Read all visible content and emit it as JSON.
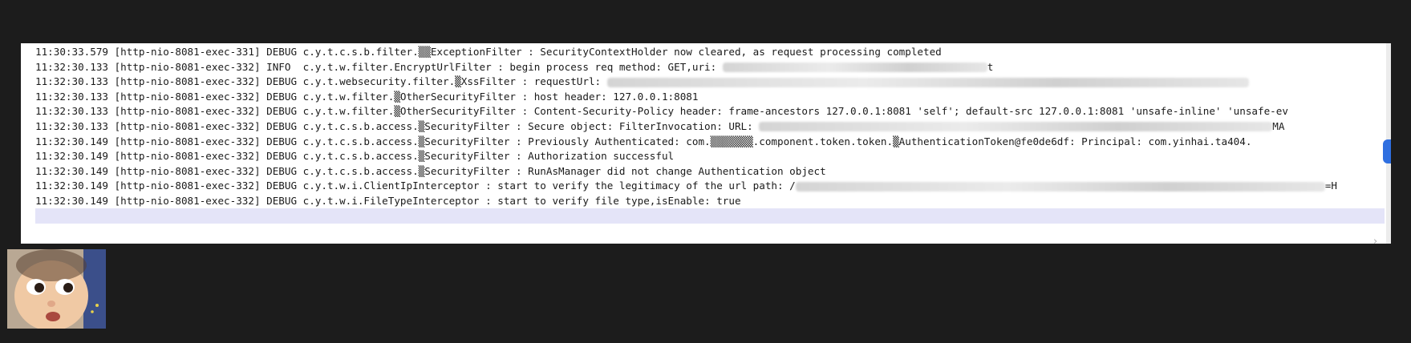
{
  "log": {
    "lines": [
      {
        "text": "11:30:33.579 [http-nio-8081-exec-331] DEBUG c.y.t.c.s.b.filter.▒▒ExceptionFilter : SecurityContextHolder now cleared, as request processing completed"
      },
      {
        "text": "11:32:30.133 [http-nio-8081-exec-332] INFO  c.y.t.w.filter.EncryptUrlFilter : begin process req method: GET,uri: ",
        "redacted_tail": true,
        "tail": "t"
      },
      {
        "text": "11:32:30.133 [http-nio-8081-exec-332] DEBUG c.y.t.websecurity.filter.▒XssFilter : requestUrl: ",
        "redacted_tail": true,
        "tail": ""
      },
      {
        "text": "11:32:30.133 [http-nio-8081-exec-332] DEBUG c.y.t.w.filter.▒OtherSecurityFilter : host header: 127.0.0.1:8081"
      },
      {
        "text": "11:32:30.133 [http-nio-8081-exec-332] DEBUG c.y.t.w.filter.▒OtherSecurityFilter : Content-Security-Policy header: frame-ancestors 127.0.0.1:8081 'self'; default-src 127.0.0.1:8081 'unsafe-inline' 'unsafe-ev"
      },
      {
        "text": "11:32:30.133 [http-nio-8081-exec-332] DEBUG c.y.t.c.s.b.access.▒SecurityFilter : Secure object: FilterInvocation: URL: ",
        "redacted_tail": true,
        "tail": "MA"
      },
      {
        "text": "11:32:30.149 [http-nio-8081-exec-332] DEBUG c.y.t.c.s.b.access.▒SecurityFilter : Previously Authenticated: com.▒▒▒▒▒▒▒.component.token.token.▒AuthenticationToken@fe0de6df: Principal: com.yinhai.ta404."
      },
      {
        "text": "11:32:30.149 [http-nio-8081-exec-332] DEBUG c.y.t.c.s.b.access.▒SecurityFilter : Authorization successful"
      },
      {
        "text": "11:32:30.149 [http-nio-8081-exec-332] DEBUG c.y.t.c.s.b.access.▒SecurityFilter : RunAsManager did not change Authentication object"
      },
      {
        "text": "11:32:30.149 [http-nio-8081-exec-332] DEBUG c.y.t.w.i.ClientIpInterceptor : start to verify the legitimacy of the url path: /",
        "redacted_tail": true,
        "tail": "=H"
      },
      {
        "text": "11:32:30.149 [http-nio-8081-exec-332] DEBUG c.y.t.w.i.FileTypeInterceptor : start to verify file type,isEnable: true"
      }
    ]
  },
  "icons": {
    "scroll_chevron": "chevron-right-icon",
    "avatar": "toddler-avatar-icon"
  },
  "colors": {
    "page_bg": "#1c1c1c",
    "panel_bg": "#ffffff",
    "current_line": "#e4e4f8",
    "text": "#1a1a1a",
    "scroll_marker": "#2f6fe0"
  }
}
